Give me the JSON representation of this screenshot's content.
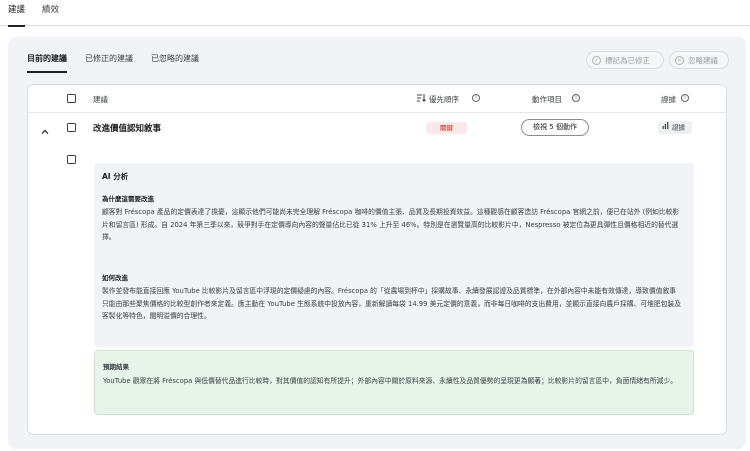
{
  "top_tabs": [
    {
      "label": "建議",
      "active": true
    },
    {
      "label": "績效",
      "active": false
    }
  ],
  "sub_tabs": [
    {
      "label": "目前的建議",
      "active": true
    },
    {
      "label": "已修正的建議",
      "active": false
    },
    {
      "label": "已忽略的建議",
      "active": false
    }
  ],
  "header_buttons": {
    "mark_fixed": "標記為已修正",
    "ignore": "忽略建議"
  },
  "table": {
    "columns": {
      "suggestion": "建議",
      "priority": "優先順序",
      "actions": "動作項目",
      "evidence": "證據"
    }
  },
  "row": {
    "title": "改進價值認知敘事",
    "priority": "關鍵",
    "action_button": "檢視 5 個動作",
    "evidence_button": "證據"
  },
  "analysis": {
    "title": "AI 分析",
    "why_heading": "為什麼這需要改進",
    "why_text": "顧客對 Fréscopa 產品的定價表達了擔憂，這顯示他們可能尚未完全理解 Fréscopa 咖啡的價值主張、品質及長期投資效益。這種觀感在顧客造訪 Fréscopa 官網之前，便已在站外 (例如比較影片和留言區) 形成。自 2024 年第三季以來，競爭對手在定價導向內容的聲量佔比已從 31% 上升至 46%。特別是在瀏覽量高的比較影片中，Nespresso 被定位為更具彈性且價格相近的替代選擇。",
    "how_heading": "如何改進",
    "how_text": "製作並發布能直接回應 YouTube 比較影片及留言區中浮現的定價疑慮的內容。Fréscopa 的「從農場到杯中」採購故事、永續發展認證及品質標準，在外部內容中未能有效傳達，導致價值敘事只能由那些聚焦價格的比較型創作者來定義。應主動在 YouTube 生態系統中投放內容，重新解讀每袋 14.99 美元定價的意義，而非每日咖啡的支出費用，並顯示直接向農戶採購、可堆肥包裝及客製化等特色，闡明溢價的合理性。"
  },
  "expected": {
    "heading": "預期結果",
    "text": "YouTube 觀眾在將 Fréscopa 與低價替代品進行比較時，對其價值的認知有所提升；外部內容中關於原料來源、永續性及品質優勢的呈現更為顯著；比較影片的留言區中，負面情緒有所減少。"
  },
  "colors": {
    "accent": "#202124",
    "critical_bg": "#fce8e6",
    "critical_fg": "#c5221f",
    "panel_bg": "#f1f3f7",
    "success_bg": "#e6f4ea"
  }
}
